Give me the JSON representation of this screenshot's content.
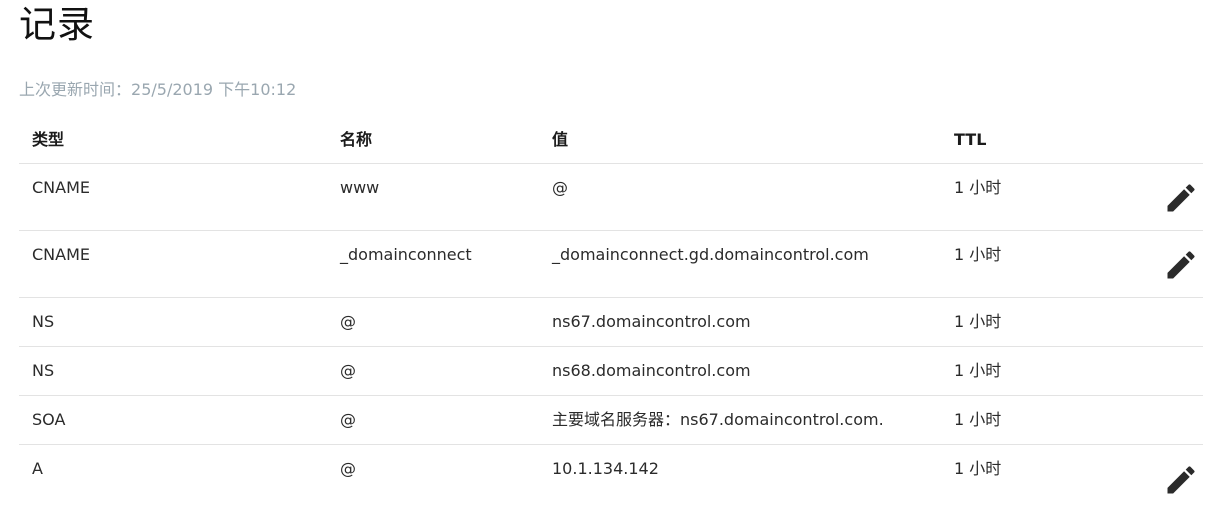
{
  "page": {
    "title": "记录",
    "updated_label": "上次更新时间：",
    "updated_value": "25/5/2019 下午10:12"
  },
  "table": {
    "headers": {
      "type": "类型",
      "name": "名称",
      "value": "值",
      "ttl": "TTL"
    },
    "rows": [
      {
        "type": "CNAME",
        "name": "www",
        "value": "@",
        "ttl": "1 小时",
        "editable": true
      },
      {
        "type": "CNAME",
        "name": "_domainconnect",
        "value": "_domainconnect.gd.domaincontrol.com",
        "ttl": "1 小时",
        "editable": true
      },
      {
        "type": "NS",
        "name": "@",
        "value": "ns67.domaincontrol.com",
        "ttl": "1 小时",
        "editable": false
      },
      {
        "type": "NS",
        "name": "@",
        "value": "ns68.domaincontrol.com",
        "ttl": "1 小时",
        "editable": false
      },
      {
        "type": "SOA",
        "name": "@",
        "value": "主要域名服务器：ns67.domaincontrol.com.",
        "ttl": "1 小时",
        "editable": false
      },
      {
        "type": "A",
        "name": "@",
        "value": "10.1.134.142",
        "ttl": "1 小时",
        "editable": true
      }
    ]
  },
  "icons": {
    "edit": "pencil-icon"
  },
  "colors": {
    "text": "#2b2b2b",
    "muted": "#9aa7b0",
    "divider": "#e3e3e3",
    "icon": "#2b2b2b"
  }
}
